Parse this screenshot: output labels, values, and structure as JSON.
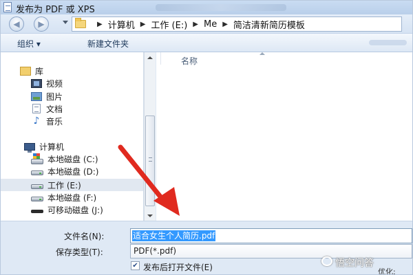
{
  "window": {
    "title": "发布为 PDF 或 XPS"
  },
  "address_bar": {
    "crumbs": [
      "计算机",
      "工作 (E:)",
      "Me",
      "简洁清新简历模板"
    ]
  },
  "toolbar": {
    "organize_label": "组织 ▾",
    "new_folder_label": "新建文件夹"
  },
  "nav_pane": {
    "items": [
      {
        "label": "库",
        "icon": "library-icon"
      },
      {
        "label": "视频",
        "icon": "video-icon"
      },
      {
        "label": "图片",
        "icon": "picture-icon"
      },
      {
        "label": "文档",
        "icon": "document-icon"
      },
      {
        "label": "音乐",
        "icon": "music-icon"
      },
      {
        "label": "计算机",
        "icon": "computer-icon"
      },
      {
        "label": "本地磁盘 (C:)",
        "icon": "system-drive-icon"
      },
      {
        "label": "本地磁盘 (D:)",
        "icon": "drive-icon"
      },
      {
        "label": "工作 (E:)",
        "icon": "drive-icon",
        "selected": true
      },
      {
        "label": "本地磁盘 (F:)",
        "icon": "drive-icon"
      },
      {
        "label": "可移动磁盘 (J:)",
        "icon": "usb-drive-icon"
      }
    ]
  },
  "file_list": {
    "column_name": "名称"
  },
  "form": {
    "filename_label": "文件名(N):",
    "filename_value": "适合女生个人简历.pdf",
    "savetype_label": "保存类型(T):",
    "savetype_value": "PDF(*.pdf)",
    "open_after_publish_label": "发布后打开文件(E)",
    "open_after_publish_checked": true,
    "partial_button_label": "优化:"
  },
  "annotation": {
    "arrow_color": "#e02a1f"
  },
  "watermark": {
    "text": "悟空问答"
  },
  "colors": {
    "selection": "#3399ff",
    "chrome": "#dfe9f5",
    "accent_text": "#1e395b"
  }
}
